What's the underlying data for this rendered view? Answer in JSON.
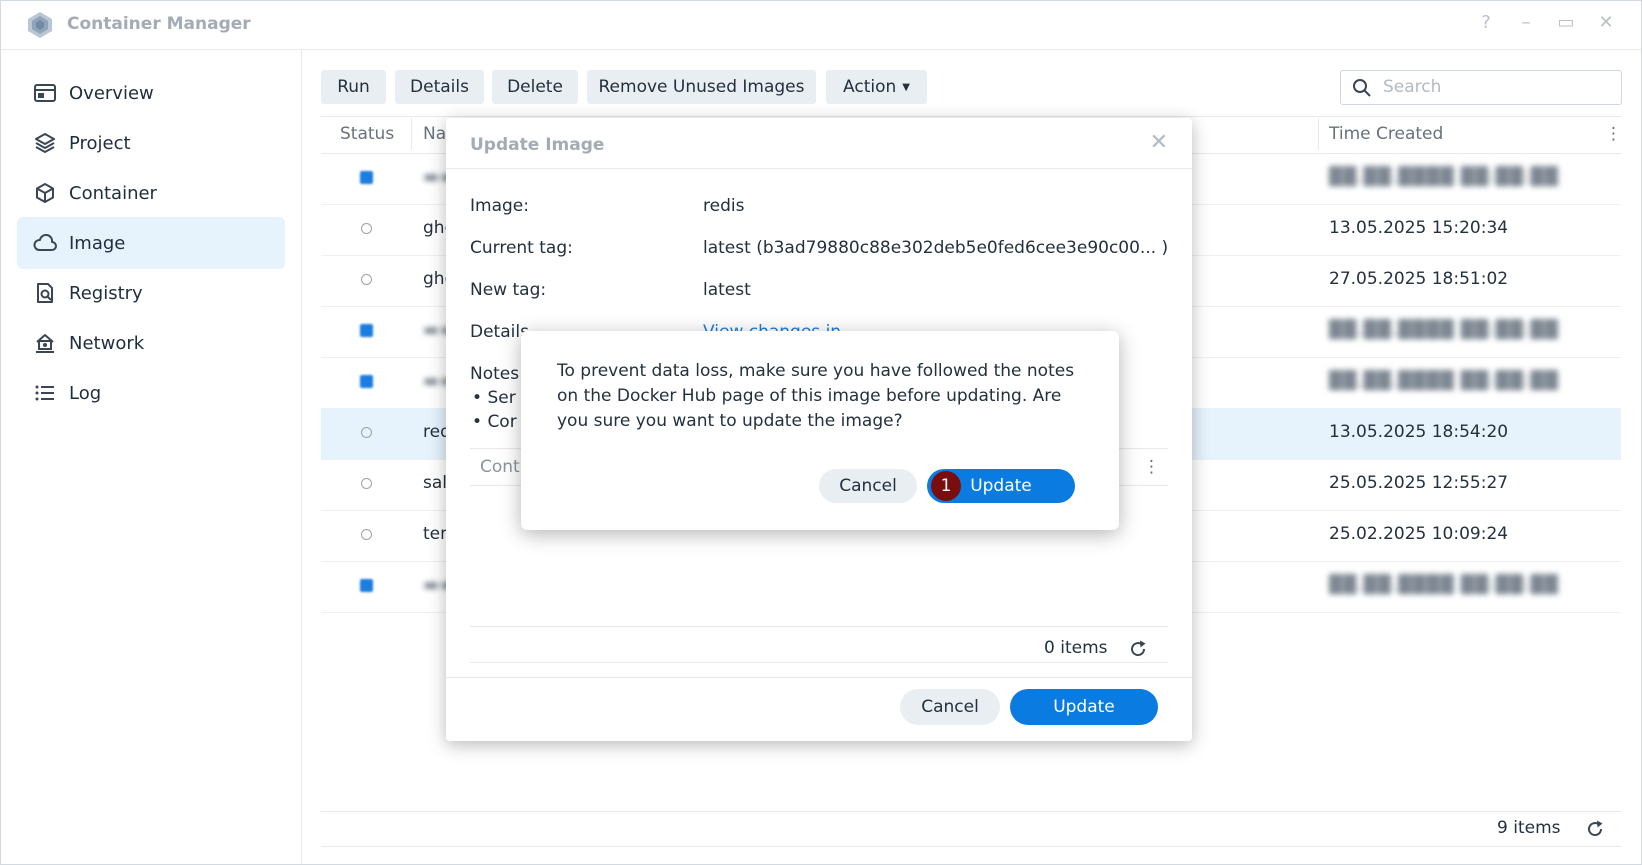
{
  "app": {
    "title": "Container Manager",
    "help_icon": "question-icon",
    "colors": {
      "accent": "#0a7be0",
      "selected_row": "#e6f2fc",
      "step_badge": "#7a0d10"
    }
  },
  "window_controls": {
    "help": "?",
    "minimize": "–",
    "maximize": "▭",
    "close": "✕"
  },
  "sidebar": {
    "items": [
      {
        "label": "Overview",
        "icon": "overview-icon"
      },
      {
        "label": "Project",
        "icon": "layers-icon"
      },
      {
        "label": "Container",
        "icon": "cube-icon"
      },
      {
        "label": "Image",
        "icon": "cloud-icon",
        "active": true
      },
      {
        "label": "Registry",
        "icon": "registry-icon"
      },
      {
        "label": "Network",
        "icon": "network-icon"
      },
      {
        "label": "Log",
        "icon": "list-icon"
      }
    ]
  },
  "toolbar": {
    "run": "Run",
    "details": "Details",
    "delete": "Delete",
    "remove_unused": "Remove Unused Images",
    "action": "Action",
    "search_placeholder": "Search"
  },
  "table": {
    "headers": {
      "status": "Status",
      "name": "Na",
      "time": "Time Created"
    },
    "rows": [
      {
        "status": "running",
        "name": "▬▬▬",
        "time": "██.██.████ ██:██:██",
        "blurred": true
      },
      {
        "status": "idle",
        "name": "ghc",
        "time": "13.05.2025 15:20:34"
      },
      {
        "status": "idle",
        "name": "ghc",
        "time": "27.05.2025 18:51:02"
      },
      {
        "status": "running",
        "name": "▬▬",
        "time": "██.██.████ ██:██:██",
        "blurred": true
      },
      {
        "status": "running",
        "name": "▬▬",
        "time": "██.██.████ ██:██:██",
        "blurred": true
      },
      {
        "status": "idle",
        "name": "red",
        "time": "13.05.2025 18:54:20",
        "selected": true
      },
      {
        "status": "idle",
        "name": "sal",
        "time": "25.05.2025 12:55:27"
      },
      {
        "status": "idle",
        "name": "ten",
        "time": "25.02.2025 10:09:24"
      },
      {
        "status": "running",
        "name": "▬▬",
        "time": "██.██.████ ██:██:██",
        "blurred": true
      }
    ],
    "items_count": "9 items"
  },
  "update_dialog": {
    "title": "Update Image",
    "image_label": "Image:",
    "image_value": "redis",
    "current_tag_label": "Current tag:",
    "current_tag_value": "latest (b3ad79880c88e302deb5e0fed6cee3e90c00... )",
    "new_tag_label": "New tag:",
    "new_tag_value": "latest",
    "details_label": "Details",
    "details_link": "View changes in ...",
    "notes_label": "Notes:",
    "notes": [
      "Ser",
      "Cor"
    ],
    "sub_table_header": "Cont",
    "items_count": "0 items",
    "cancel": "Cancel",
    "update": "Update"
  },
  "confirm_dialog": {
    "message": "To prevent data loss, make sure you have followed the notes on the Docker Hub page of this image before updating. Are you sure you want to update the image?",
    "cancel": "Cancel",
    "update": "Update",
    "step": "1"
  }
}
